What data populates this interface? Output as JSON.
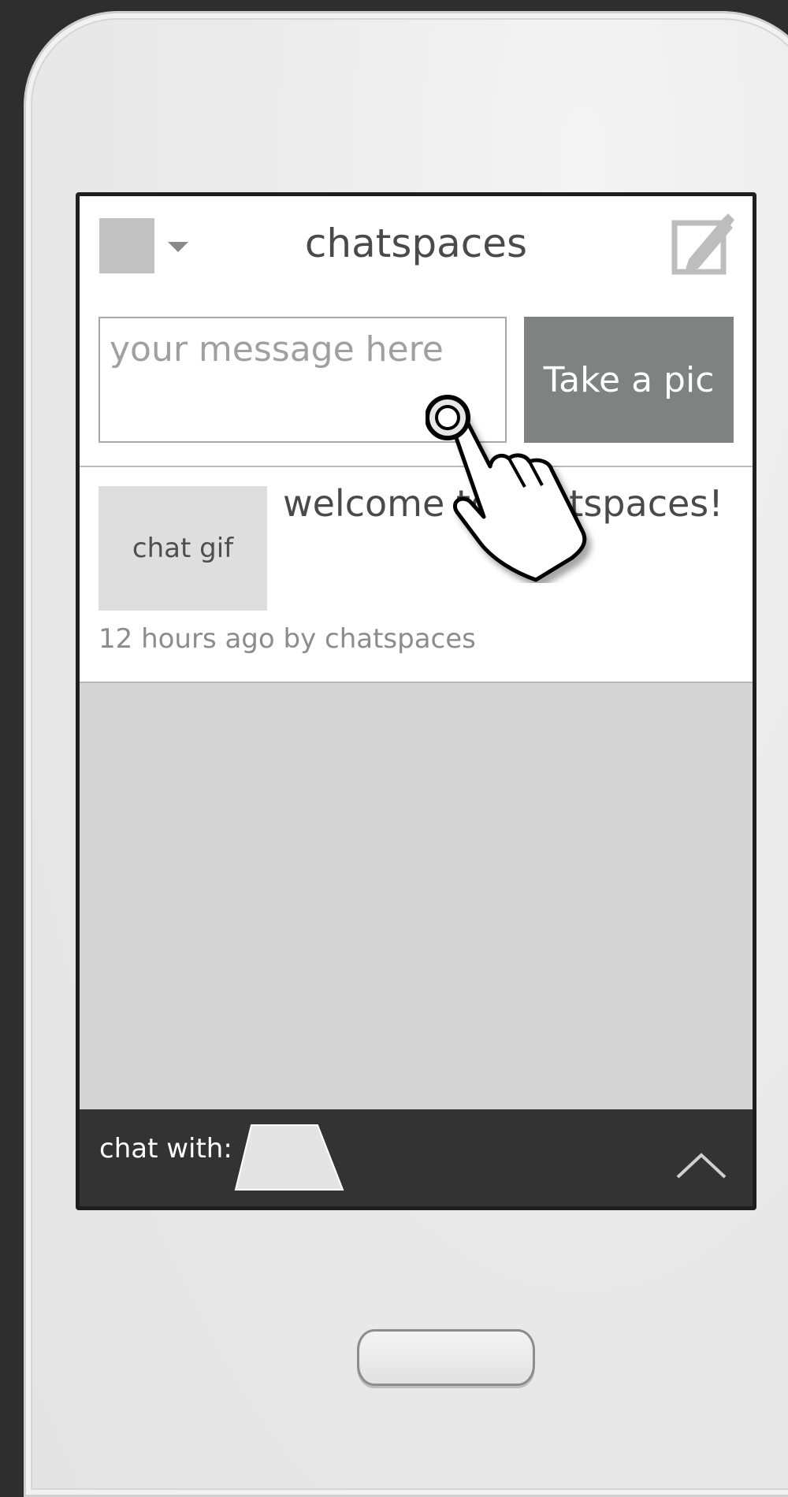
{
  "header": {
    "title": "chatspaces",
    "menu_icon": "avatar-square",
    "caret_icon": "caret-down-icon",
    "compose_icon": "compose-icon"
  },
  "composer": {
    "placeholder": "your message here",
    "value": "",
    "pic_button_label": "Take a pic"
  },
  "posts": [
    {
      "thumb_label": "chat gif",
      "text": "welcome to chatspaces!",
      "meta": "12 hours ago by chatspaces"
    }
  ],
  "footer": {
    "chat_with_label": "chat with:",
    "expand_icon": "chevron-up-icon"
  },
  "overlay": {
    "pointer_icon": "hand-pointer-icon"
  },
  "colors": {
    "background": "#2e2e2e",
    "screen_bg": "#d5d5d5",
    "button_bg": "#7f8280",
    "footer_bg": "#333333"
  }
}
